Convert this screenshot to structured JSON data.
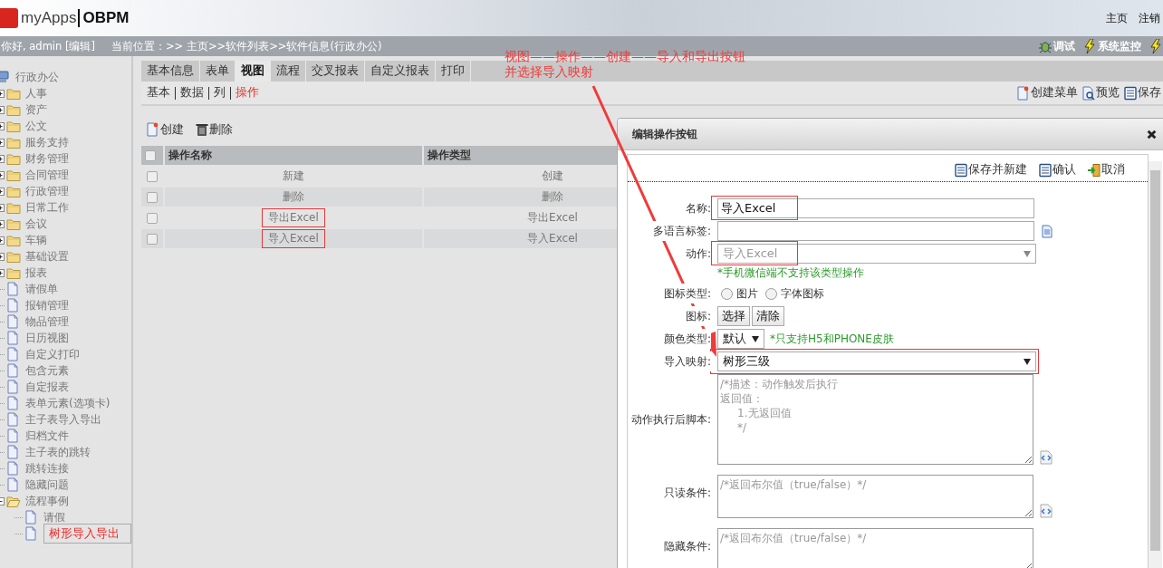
{
  "header": {
    "logo_text": "myApps",
    "product": "OBPM",
    "links": [
      "主页",
      "注销"
    ]
  },
  "infobar": {
    "greeting": "你好, admin [编辑]",
    "breadcrumb": "当前位置：>> 主页>>软件列表>>软件信息(行政办公)",
    "tools": [
      {
        "label": "调试",
        "kind": "bug"
      },
      {
        "label": "系统监控",
        "kind": "bolt"
      },
      {
        "kind": "bolt"
      }
    ]
  },
  "sidebar": {
    "tree": [
      {
        "label": "行政办公",
        "kind": "root",
        "selected": false,
        "children": [
          {
            "label": "人事",
            "kind": "folder",
            "expanded": false,
            "selected": false
          },
          {
            "label": "资产",
            "kind": "folder",
            "expanded": false,
            "selected": false
          },
          {
            "label": "公文",
            "kind": "folder",
            "expanded": false,
            "selected": false
          },
          {
            "label": "服务支持",
            "kind": "folder",
            "expanded": false,
            "selected": false
          },
          {
            "label": "财务管理",
            "kind": "folder",
            "expanded": false,
            "selected": false
          },
          {
            "label": "合同管理",
            "kind": "folder",
            "expanded": false,
            "selected": false
          },
          {
            "label": "行政管理",
            "kind": "folder",
            "expanded": false,
            "selected": false
          },
          {
            "label": "日常工作",
            "kind": "folder",
            "expanded": false,
            "selected": false
          },
          {
            "label": "会议",
            "kind": "folder",
            "expanded": false,
            "selected": false
          },
          {
            "label": "车辆",
            "kind": "folder",
            "expanded": false,
            "selected": false
          },
          {
            "label": "基础设置",
            "kind": "folder",
            "expanded": false,
            "selected": false
          },
          {
            "label": "报表",
            "kind": "folder",
            "expanded": false,
            "selected": false
          },
          {
            "label": "请假单",
            "kind": "page",
            "selected": false
          },
          {
            "label": "报销管理",
            "kind": "page",
            "selected": false
          },
          {
            "label": "物品管理",
            "kind": "page",
            "selected": false
          },
          {
            "label": "日历视图",
            "kind": "page",
            "selected": false
          },
          {
            "label": "自定义打印",
            "kind": "page",
            "selected": false
          },
          {
            "label": "包含元素",
            "kind": "page",
            "selected": false
          },
          {
            "label": "自定报表",
            "kind": "page",
            "selected": false
          },
          {
            "label": "表单元素(选项卡)",
            "kind": "page",
            "selected": false
          },
          {
            "label": "主子表导入导出",
            "kind": "page",
            "selected": false
          },
          {
            "label": "归档文件",
            "kind": "page",
            "selected": false
          },
          {
            "label": "主子表的跳转",
            "kind": "page",
            "selected": false
          },
          {
            "label": "跳转连接",
            "kind": "page",
            "selected": false
          },
          {
            "label": "隐藏问题",
            "kind": "page",
            "selected": false
          },
          {
            "label": "流程事例",
            "kind": "folder",
            "expanded": true,
            "selected": false,
            "children": [
              {
                "label": "请假",
                "kind": "page",
                "selected": false
              },
              {
                "label": "树形导入导出",
                "kind": "page",
                "selected": true
              }
            ]
          }
        ]
      }
    ]
  },
  "tabs": [
    {
      "label": "基本信息",
      "selected": false
    },
    {
      "label": "表单",
      "selected": false
    },
    {
      "label": "视图",
      "selected": true
    },
    {
      "label": "流程",
      "selected": false
    },
    {
      "label": "交叉报表",
      "selected": false
    },
    {
      "label": "自定义报表",
      "selected": false
    },
    {
      "label": "打印",
      "selected": false
    }
  ],
  "subtabs": [
    {
      "label": "基本",
      "selected": false
    },
    {
      "label": "数据",
      "selected": false
    },
    {
      "label": "列",
      "selected": false
    },
    {
      "label": "操作",
      "selected": true
    }
  ],
  "page_actions": [
    {
      "label": "创建菜单",
      "kind": "new"
    },
    {
      "label": "预览",
      "kind": "preview"
    },
    {
      "label": "保存",
      "kind": "save"
    }
  ],
  "list_actions": [
    {
      "label": "创建",
      "kind": "new"
    },
    {
      "label": "删除",
      "kind": "trash"
    }
  ],
  "table": {
    "select_all_checked": false,
    "columns": [
      "操作名称",
      "操作类型"
    ],
    "rows": [
      {
        "checked": false,
        "name": "新建",
        "type": "创建",
        "highlighted": false
      },
      {
        "checked": false,
        "name": "删除",
        "type": "删除",
        "highlighted": false
      },
      {
        "checked": false,
        "name": "导出Excel",
        "type": "导出Excel",
        "highlighted": true
      },
      {
        "checked": false,
        "name": "导入Excel",
        "type": "导入Excel",
        "highlighted": true
      }
    ]
  },
  "annotation": {
    "lines": [
      "视图——操作——创建——导入和导出按钮",
      "并选择导入映射"
    ]
  },
  "dialog": {
    "title": "编辑操作按钮",
    "actions": [
      {
        "label": "保存并新建",
        "kind": "save"
      },
      {
        "label": "确认",
        "kind": "save"
      },
      {
        "label": "取消",
        "kind": "exit"
      }
    ],
    "fields": [
      {
        "kind": "text",
        "label": "名称:",
        "value": "导入Excel",
        "value_highlighted": true
      },
      {
        "kind": "text",
        "label": "多语言标签:",
        "has_label_button": true
      },
      {
        "kind": "select",
        "label": "动作:",
        "value": "导入Excel",
        "disabled": true,
        "value_highlighted": true,
        "note": "*手机微信端不支持该类型操作"
      },
      {
        "kind": "radio",
        "label": "图标类型:",
        "options": [
          {
            "label": "图片",
            "selected": false
          },
          {
            "label": "字体图标",
            "selected": false
          }
        ]
      },
      {
        "kind": "buttons",
        "label": "图标:",
        "buttons": [
          "选择",
          "清除"
        ]
      },
      {
        "kind": "small-select",
        "label": "颜色类型:",
        "value": "默认",
        "note": "*只支持H5和PHONE皮肤"
      },
      {
        "kind": "select",
        "label": "导入映射:",
        "value": "树形三级",
        "disabled": false,
        "highlighted": true
      },
      {
        "kind": "script-area",
        "label": "动作执行后脚本:",
        "placeholder_lines": [
          "/*描述：动作触发后执行",
          "返回值：",
          "     1.无返回值",
          "     */"
        ],
        "has_script_button": true
      },
      {
        "kind": "condition-area",
        "label": "只读条件:",
        "placeholder_lines": [
          "/*返回布尔值（true/false）*/"
        ],
        "has_script_button": true
      },
      {
        "kind": "condition-area",
        "label": "隐藏条件:",
        "placeholder_lines": [
          "/*返回布尔值（true/false）*/"
        ]
      }
    ]
  }
}
